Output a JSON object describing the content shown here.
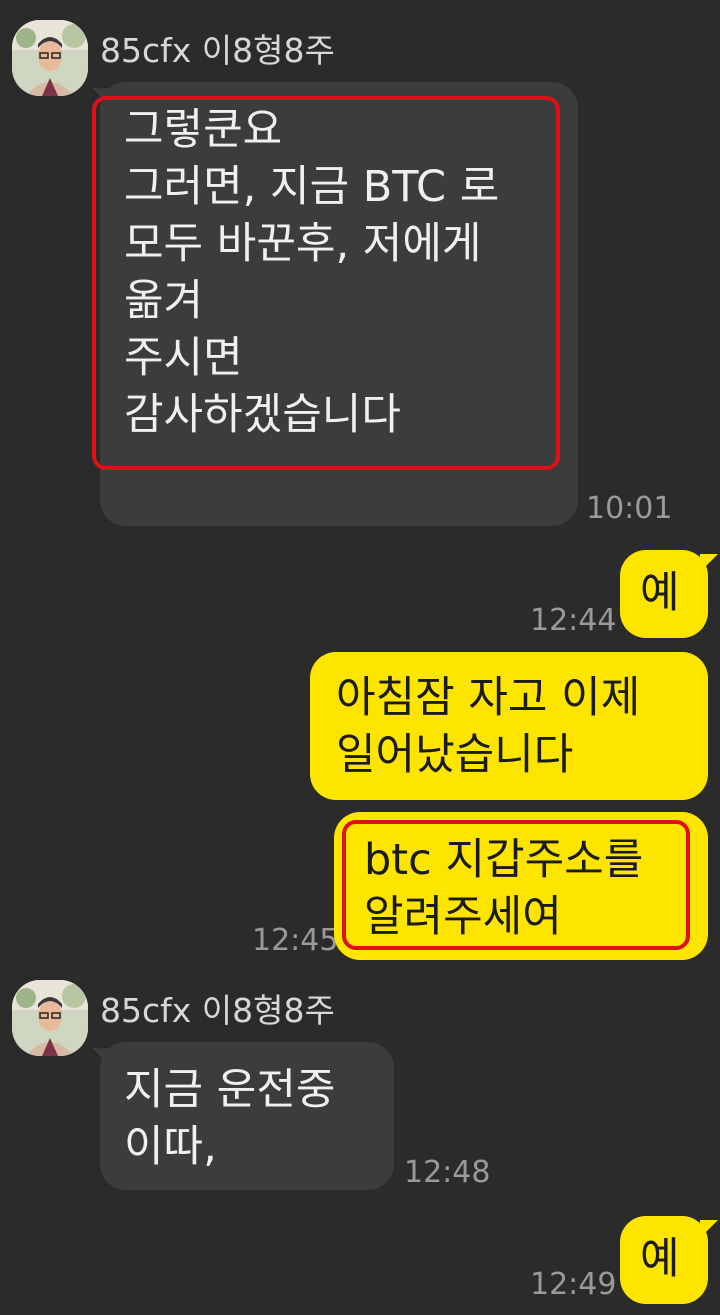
{
  "messages": {
    "m1": {
      "sender": "85cfx 이8형8주",
      "lines": [
        "그렇쿤요",
        "그러면, 지금 BTC 로",
        "모두 바꾼후, 저에게",
        "옮겨",
        "주시면",
        "감사하겠습니다"
      ],
      "time": "10:01"
    },
    "m2": {
      "lines": [
        "예"
      ],
      "time": "12:44"
    },
    "m3": {
      "lines": [
        "아침잠 자고 이제",
        "일어났습니다"
      ]
    },
    "m4": {
      "lines": [
        "btc 지갑주소를",
        "알려주세여"
      ],
      "time": "12:45"
    },
    "m5": {
      "sender": "85cfx 이8형8주",
      "lines": [
        "지금 운전중",
        "이따,"
      ],
      "time": "12:48"
    },
    "m6": {
      "lines": [
        "예"
      ],
      "time": "12:49"
    }
  },
  "colors": {
    "background": "#2b2b2b",
    "incoming_bubble": "#3c3c3c",
    "outgoing_bubble": "#fee500",
    "highlight_box": "#e0101a"
  },
  "icons": {
    "avatar": "profile-photo-avatar"
  }
}
